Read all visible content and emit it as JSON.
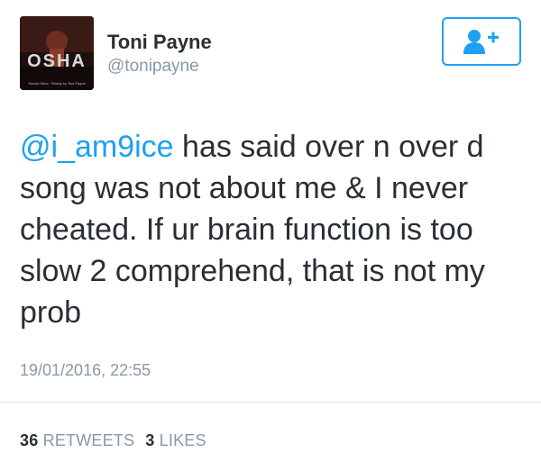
{
  "user": {
    "display_name": "Toni Payne",
    "handle": "@tonipayne",
    "avatar_icon": "profile-photo",
    "avatar_text": "OSHA",
    "avatar_caption": "Smoke Mind · Ready by Toni Payne"
  },
  "follow_button": {
    "icon": "add-user-icon",
    "color": "#1da1f2"
  },
  "tweet": {
    "mention": "@i_am9ice",
    "body": " has said over n over d song was not about me & I never cheated. If ur brain function is too slow 2 comprehend, that is not my prob",
    "timestamp": "19/01/2016, 22:55"
  },
  "stats": {
    "retweets_count": "36",
    "retweets_label": "RETWEETS",
    "likes_count": "3",
    "likes_label": "LIKES"
  },
  "colors": {
    "text": "#292f33",
    "secondary": "#8899a6",
    "link": "#1da1f2",
    "divider": "#e1e8ed"
  }
}
